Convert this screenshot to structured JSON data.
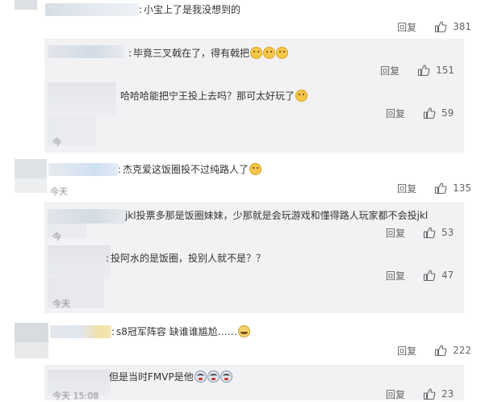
{
  "labels": {
    "reply": "回复"
  },
  "colors": {
    "reply_bg": "#f2f2f5",
    "page_bg": "#ffffff",
    "text": "#333333",
    "meta": "#666666"
  },
  "icons": {
    "like": "thumbs-up-icon",
    "emoji_doge": "doge-emoji-icon",
    "emoji_grin": "grin-emoji-icon",
    "emoji_cry": "cry-emoji-icon"
  },
  "comments": [
    {
      "type": "top",
      "text": "小宝上了是我没想到的",
      "likes": "381"
    },
    {
      "type": "reply",
      "text": "毕竟三叉戟在了，得有戟把",
      "likes": "151"
    },
    {
      "type": "reply",
      "text": "哈哈哈能把宁王投上去吗？那可太好玩了",
      "likes": "59",
      "time_fragment": "今"
    },
    {
      "type": "top",
      "text": "杰克爱这饭圈投不过纯路人了",
      "likes": "135",
      "time_fragment": "今天"
    },
    {
      "type": "reply",
      "text": "jkl投票多那是饭圈妹妹，少那就是会玩游戏和懂得路人玩家都不会投jkl",
      "likes": "53",
      "time_fragment": "今"
    },
    {
      "type": "reply",
      "text": "投阿水的是饭圈，投别人就不是？？",
      "likes": "47",
      "time_fragment": "今天"
    },
    {
      "type": "top",
      "text": "s8冠军阵容 缺谁谁尴尬……",
      "likes": "222"
    },
    {
      "type": "reply",
      "text": "但是当时FMVP是他",
      "likes": "23",
      "time_fragment": "今天 15:08"
    }
  ]
}
